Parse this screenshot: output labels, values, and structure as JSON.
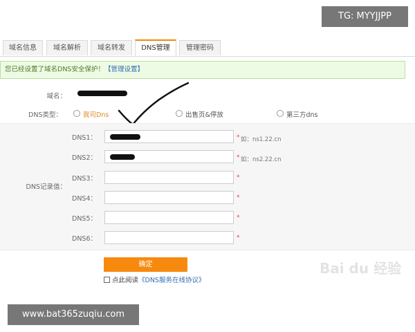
{
  "overlay": {
    "tg_label": "TG: MYYJJPP",
    "site_label": "www.bat365zuqiu.com"
  },
  "watermark": "Bai du 经验",
  "tabs": [
    {
      "label": "域名信息"
    },
    {
      "label": "域名解析"
    },
    {
      "label": "域名转发"
    },
    {
      "label": "DNS管理",
      "active": true
    },
    {
      "label": "管理密码"
    }
  ],
  "notice": {
    "text": "您已经设置了域名DNS安全保护！",
    "link": "【管理设置】"
  },
  "domain": {
    "label": "域名："
  },
  "dns_type": {
    "label": "DNS类型：",
    "options": [
      {
        "label": "我司Dns",
        "selected": true
      },
      {
        "label": "出售页&停放"
      },
      {
        "label": "第三方dns"
      }
    ]
  },
  "dns_records": {
    "label": "DNS记录值：",
    "rows": [
      {
        "label": "DNS1：",
        "hint": "如：ns1.22.cn"
      },
      {
        "label": "DNS2：",
        "hint": "如：ns2.22.cn"
      },
      {
        "label": "DNS3："
      },
      {
        "label": "DNS4："
      },
      {
        "label": "DNS5："
      },
      {
        "label": "DNS6："
      }
    ],
    "required_mark": "*"
  },
  "submit": {
    "label": "确定"
  },
  "agreement": {
    "prefix": "点此阅读",
    "link": "《DNS服务在线协议》"
  },
  "colors": {
    "accent": "#f78a0e",
    "link": "#2f6bb3",
    "notice_bg": "#eefbe4"
  }
}
